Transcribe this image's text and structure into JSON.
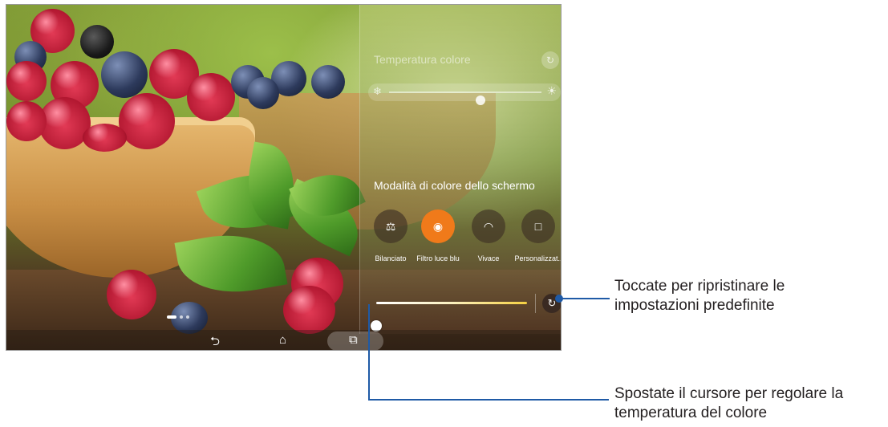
{
  "panel": {
    "temperature_title": "Temperatura colore",
    "temperature_slider_level": 0.6,
    "screen_color_mode_title": "Modalità di colore dello schermo",
    "modes": [
      {
        "label": "Bilanciato",
        "icon": "balance-scale-icon",
        "active": false
      },
      {
        "label": "Filtro luce blu",
        "icon": "eye-shield-icon",
        "active": true
      },
      {
        "label": "Vivace",
        "icon": "vivid-rainbow-icon",
        "active": false
      },
      {
        "label": "Personalizzat..",
        "icon": "custom-screen-icon",
        "active": false
      }
    ],
    "color_slider_level": 0.0,
    "accent_color": "#f07a1a"
  },
  "navigation": {
    "back_icon": "back-icon",
    "home_icon": "home-icon",
    "recent_icon": "recent-apps-icon",
    "page_count": 3,
    "current_page": 1
  },
  "callouts": {
    "reset": "Toccate per ripristinare le impostazioni predefinite",
    "slider": "Spostate il cursore per regolare la temperatura del colore",
    "line_color": "#1f5aa6"
  }
}
